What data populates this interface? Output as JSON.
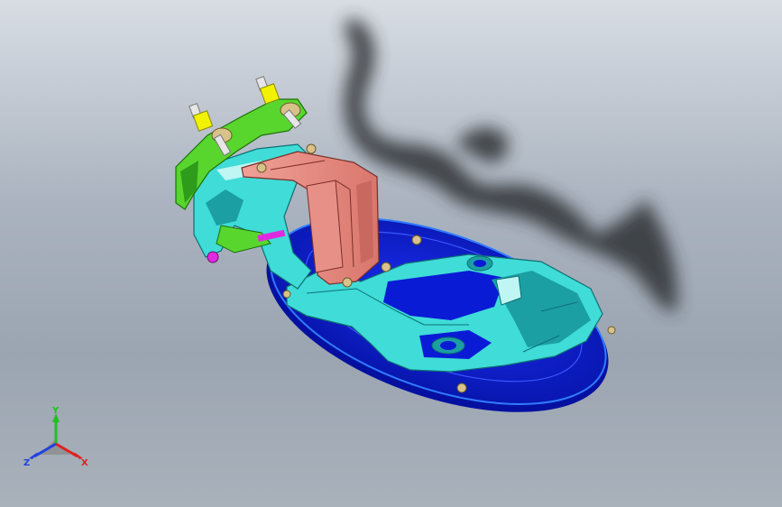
{
  "scene": {
    "model": "fuel-door-assembly",
    "colors": {
      "background_top": "#d8dde4",
      "background_bottom": "#9ba5b1",
      "shadow": "#2e3136",
      "door_panel": "#0a1bd6",
      "door_panel_rim": "#1e5fe8",
      "frame": "#3fdcd8",
      "frame_dark": "#1b9fa3",
      "hinge": "#e79088",
      "bracket": "#58d62e",
      "bolt": "#f2f200",
      "pin": "#e6e6e6",
      "accent": "#e02ae0",
      "fastener": "#d8c28a"
    }
  },
  "triad": {
    "x_label": "X",
    "y_label": "Y",
    "z_label": "Z",
    "x_color": "#e02020",
    "y_color": "#20c020",
    "z_color": "#2040e0"
  }
}
